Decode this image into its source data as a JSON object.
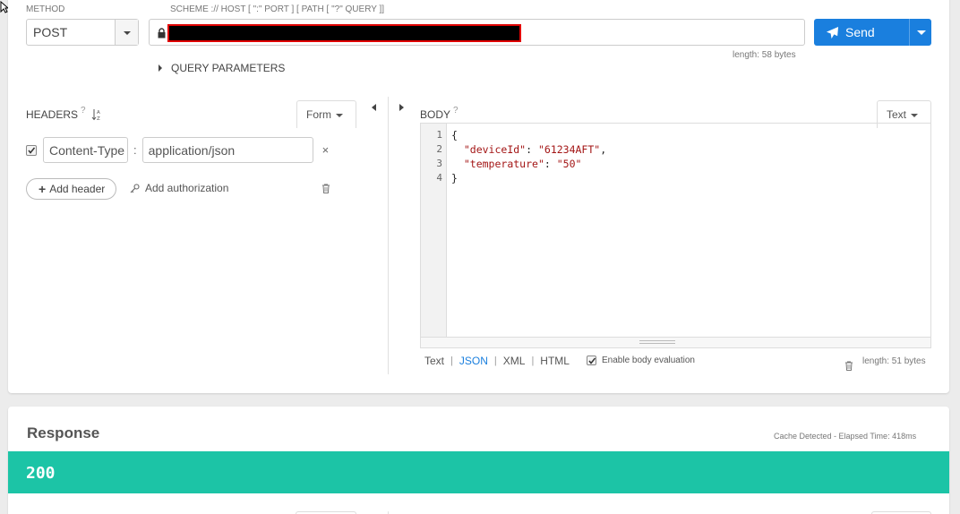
{
  "request": {
    "method_label": "METHOD",
    "method": "POST",
    "url_label": "SCHEME :// HOST [ \":\" PORT ] [ PATH [ \"?\" QUERY ]]",
    "url_length": "length: 58 bytes",
    "send_label": "Send",
    "query_params_label": "QUERY PARAMETERS"
  },
  "headers": {
    "title": "HEADERS",
    "help": "?",
    "mode_label": "Form",
    "rows": [
      {
        "enabled": true,
        "key": "Content-Type",
        "colon": ":",
        "value": "application/json",
        "remove": "×"
      }
    ],
    "add_header_label": "Add header",
    "add_auth_label": "Add authorization"
  },
  "body": {
    "title": "BODY",
    "help": "?",
    "mode_label": "Text",
    "line_numbers": [
      "1",
      "2",
      "3",
      "4"
    ],
    "code_lines": [
      {
        "pre": "{",
        "key": "",
        "mid": "",
        "val": "",
        "post": ""
      },
      {
        "pre": "  ",
        "key": "\"deviceId\"",
        "mid": ": ",
        "val": "\"61234AFT\"",
        "post": ","
      },
      {
        "pre": "  ",
        "key": "\"temperature\"",
        "mid": ": ",
        "val": "\"50\"",
        "post": ""
      },
      {
        "pre": "}",
        "key": "",
        "mid": "",
        "val": "",
        "post": ""
      }
    ],
    "format_tabs": [
      "Text",
      "JSON",
      "XML",
      "HTML"
    ],
    "active_tab": "JSON",
    "separator": "|",
    "enable_eval_label": "Enable body evaluation",
    "length": "length: 51 bytes"
  },
  "response": {
    "title": "Response",
    "elapsed": "Cache Detected - Elapsed Time: 418ms",
    "status_code": "200",
    "status_color": "#1cc4a6"
  },
  "colors": {
    "accent": "#1a7fde",
    "redaction": "#000000",
    "redaction_border": "#e00000"
  }
}
